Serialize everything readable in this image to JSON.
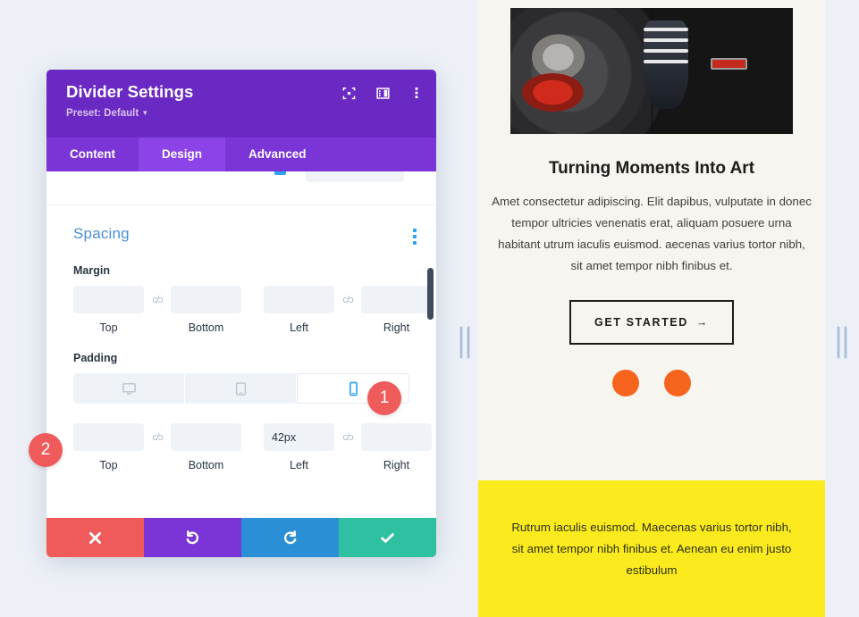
{
  "modal": {
    "title": "Divider Settings",
    "preset_label": "Preset: Default",
    "header_icons": [
      {
        "name": "focus-icon",
        "label": "Focus"
      },
      {
        "name": "layout-panel-icon",
        "label": "Layout"
      },
      {
        "name": "more-vertical-icon",
        "label": "More options"
      }
    ],
    "tabs": [
      {
        "label": "Content",
        "active": false
      },
      {
        "label": "Design",
        "active": true
      },
      {
        "label": "Advanced",
        "active": false
      }
    ],
    "section": {
      "title": "Spacing",
      "margin": {
        "label": "Margin",
        "fields": [
          {
            "label": "Top",
            "value": "",
            "placeholder": ""
          },
          {
            "label": "Bottom",
            "value": "",
            "placeholder": ""
          },
          {
            "label": "Left",
            "value": "",
            "placeholder": ""
          },
          {
            "label": "Right",
            "value": "",
            "placeholder": ""
          }
        ]
      },
      "padding": {
        "label": "Padding",
        "devices": [
          {
            "name": "desktop",
            "active": false
          },
          {
            "name": "tablet",
            "active": false
          },
          {
            "name": "phone",
            "active": true
          }
        ],
        "fields": [
          {
            "label": "Top",
            "value": "",
            "placeholder": ""
          },
          {
            "label": "Bottom",
            "value": "",
            "placeholder": ""
          },
          {
            "label": "Left",
            "value": "42px",
            "placeholder": ""
          },
          {
            "label": "Right",
            "value": "",
            "placeholder": ""
          }
        ]
      }
    },
    "footer": [
      {
        "name": "cancel",
        "icon": "close-icon",
        "color": "#ef5b5b"
      },
      {
        "name": "undo",
        "icon": "undo-icon",
        "color": "#7b34d6"
      },
      {
        "name": "redo",
        "icon": "redo-icon",
        "color": "#2a8fd4"
      },
      {
        "name": "save",
        "icon": "check-icon",
        "color": "#2ec0a0"
      }
    ]
  },
  "badges": [
    {
      "number": "1"
    },
    {
      "number": "2"
    }
  ],
  "preview": {
    "hero_alt": "laundromat washing machines",
    "title": "Turning Moments Into Art",
    "body": "Amet consectetur adipiscing. Elit dapibus, vulputate in donec tempor ultricies venenatis erat, aliquam posuere urna habitant utrum iaculis euismod. aecenas varius tortor nibh, sit amet tempor nibh finibus et.",
    "cta_label": "GET STARTED",
    "cta_arrow": "→",
    "dots": [
      {
        "color": "#f6641e"
      },
      {
        "color": "#f6641e"
      }
    ],
    "yellow_text": "Rutrum iaculis euismod. Maecenas varius tortor nibh, sit amet tempor nibh finibus et. Aenean eu enim justo estibulum"
  },
  "colors": {
    "modal_header": "#6b29c4",
    "tab_bar": "#7b34d6",
    "tab_active": "#8c43e8",
    "section_title": "#4a8fd4",
    "badge": "#ef5b5b",
    "accent_orange": "#f6641e",
    "yellow_band": "#fbeb1e",
    "page_bg": "#edf1f7"
  }
}
